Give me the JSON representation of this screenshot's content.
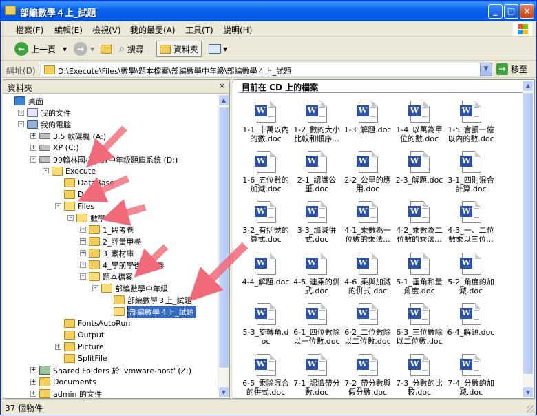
{
  "window": {
    "title": "部編數學４上_試題",
    "minimize": "_",
    "maximize": "□",
    "close": "×"
  },
  "menu": [
    "檔案(F)",
    "編輯(E)",
    "檢視(V)",
    "我的最愛(A)",
    "工具(T)",
    "說明(H)"
  ],
  "toolbar": {
    "back": "上一頁",
    "search": "搜尋",
    "folders": "資料夾"
  },
  "address": {
    "label": "網址(D)",
    "path": "D:\\Execute\\Files\\數學\\題本檔案\\部編數學中年級\\部編數學４上_試題",
    "go": "移至"
  },
  "left_pane": {
    "title": "資料夾",
    "tree": [
      {
        "label": "桌面",
        "icon": "desktop",
        "level": 0,
        "exp": ""
      },
      {
        "label": "我的文件",
        "icon": "docs",
        "level": 1,
        "exp": "+"
      },
      {
        "label": "我的電腦",
        "icon": "computer",
        "level": 1,
        "exp": "-"
      },
      {
        "label": "3.5 軟碟機 (A:)",
        "icon": "drive",
        "level": 2,
        "exp": "+"
      },
      {
        "label": "XP (C:)",
        "icon": "drive",
        "level": 2,
        "exp": "+"
      },
      {
        "label": "99翰林國小部數中年級題庫系統 (D:)",
        "icon": "drive",
        "level": 2,
        "exp": "-"
      },
      {
        "label": "Execute",
        "icon": "open",
        "level": 3,
        "exp": "-"
      },
      {
        "label": "DataBase",
        "icon": "folder",
        "level": 4,
        "exp": ""
      },
      {
        "label": "Doc",
        "icon": "folder",
        "level": 4,
        "exp": ""
      },
      {
        "label": "Files",
        "icon": "open",
        "level": 4,
        "exp": "-"
      },
      {
        "label": "數學",
        "icon": "open",
        "level": 5,
        "exp": "-"
      },
      {
        "label": "1_段考卷",
        "icon": "folder",
        "level": 6,
        "exp": "+"
      },
      {
        "label": "2_評量甲卷",
        "icon": "folder",
        "level": 6,
        "exp": "+"
      },
      {
        "label": "3_素材庫",
        "icon": "folder",
        "level": 6,
        "exp": "+"
      },
      {
        "label": "4_學前學後檢測卷",
        "icon": "folder",
        "level": 6,
        "exp": "+"
      },
      {
        "label": "題本檔案",
        "icon": "open",
        "level": 6,
        "exp": "-"
      },
      {
        "label": "部編數學中年級",
        "icon": "open",
        "level": 7,
        "exp": "-"
      },
      {
        "label": "部編數學３上_試題",
        "icon": "folder",
        "level": 8,
        "exp": ""
      },
      {
        "label": "部編數學４上_試題",
        "icon": "open",
        "level": 8,
        "exp": "",
        "selected": true
      },
      {
        "label": "FontsAutoRun",
        "icon": "folder",
        "level": 4,
        "exp": ""
      },
      {
        "label": "Output",
        "icon": "folder",
        "level": 4,
        "exp": ""
      },
      {
        "label": "Picture",
        "icon": "folder",
        "level": 4,
        "exp": "+"
      },
      {
        "label": "SplitFile",
        "icon": "folder",
        "level": 4,
        "exp": ""
      },
      {
        "label": "Shared Folders 於 'vmware-host' (Z:)",
        "icon": "net",
        "level": 2,
        "exp": "+"
      },
      {
        "label": "Documents",
        "icon": "folder",
        "level": 2,
        "exp": "+"
      },
      {
        "label": "admin 的文件",
        "icon": "folder",
        "level": 2,
        "exp": "+"
      }
    ]
  },
  "right_pane": {
    "header": "目前在 CD 上的檔案",
    "files": [
      "1-1_十萬以內的數.doc",
      "1-2_數的大小比較和順序...",
      "1-3_解題.doc",
      "1-4_以萬為單位的數.doc",
      "1-5_會讀一億以內的數.doc",
      "1-6_五位數的加減.doc",
      "2-1_認識公里.doc",
      "2-2_公里的應用.doc",
      "2-3_解題.doc",
      "3-1_四則混合計算.doc",
      "3-2_有括號的算式.doc",
      "3-3_加減併式.doc",
      "4-1_乘數為一位數的乘法...",
      "4-2_乘數為二位數的乘法...",
      "4-3_一、二位數乘以三位...",
      "4-4_解題.doc",
      "4-5_連乘的併式.doc",
      "4-6_乘與加減的併式.doc",
      "5-1_垂角和量角度.doc",
      "5-2_角度的加減.doc",
      "5-3_旋轉角.doc",
      "6-1_四位數除以一位數.doc",
      "6-2_二位數除以二位數.doc",
      "6-3_三位數除以二位數.doc",
      "6-4_解題.doc",
      "6-5_乘除混合的併式.doc",
      "7-1_認識帶分數.doc",
      "7-2_帶分數與假分數.doc",
      "7-3_分數的比較.doc",
      "7-4_分數的加減.doc"
    ]
  },
  "status": "37 個物件",
  "colors": {
    "titlebar": "#0058E6",
    "selection": "#316AC5",
    "arrow": "#F06A7A"
  }
}
